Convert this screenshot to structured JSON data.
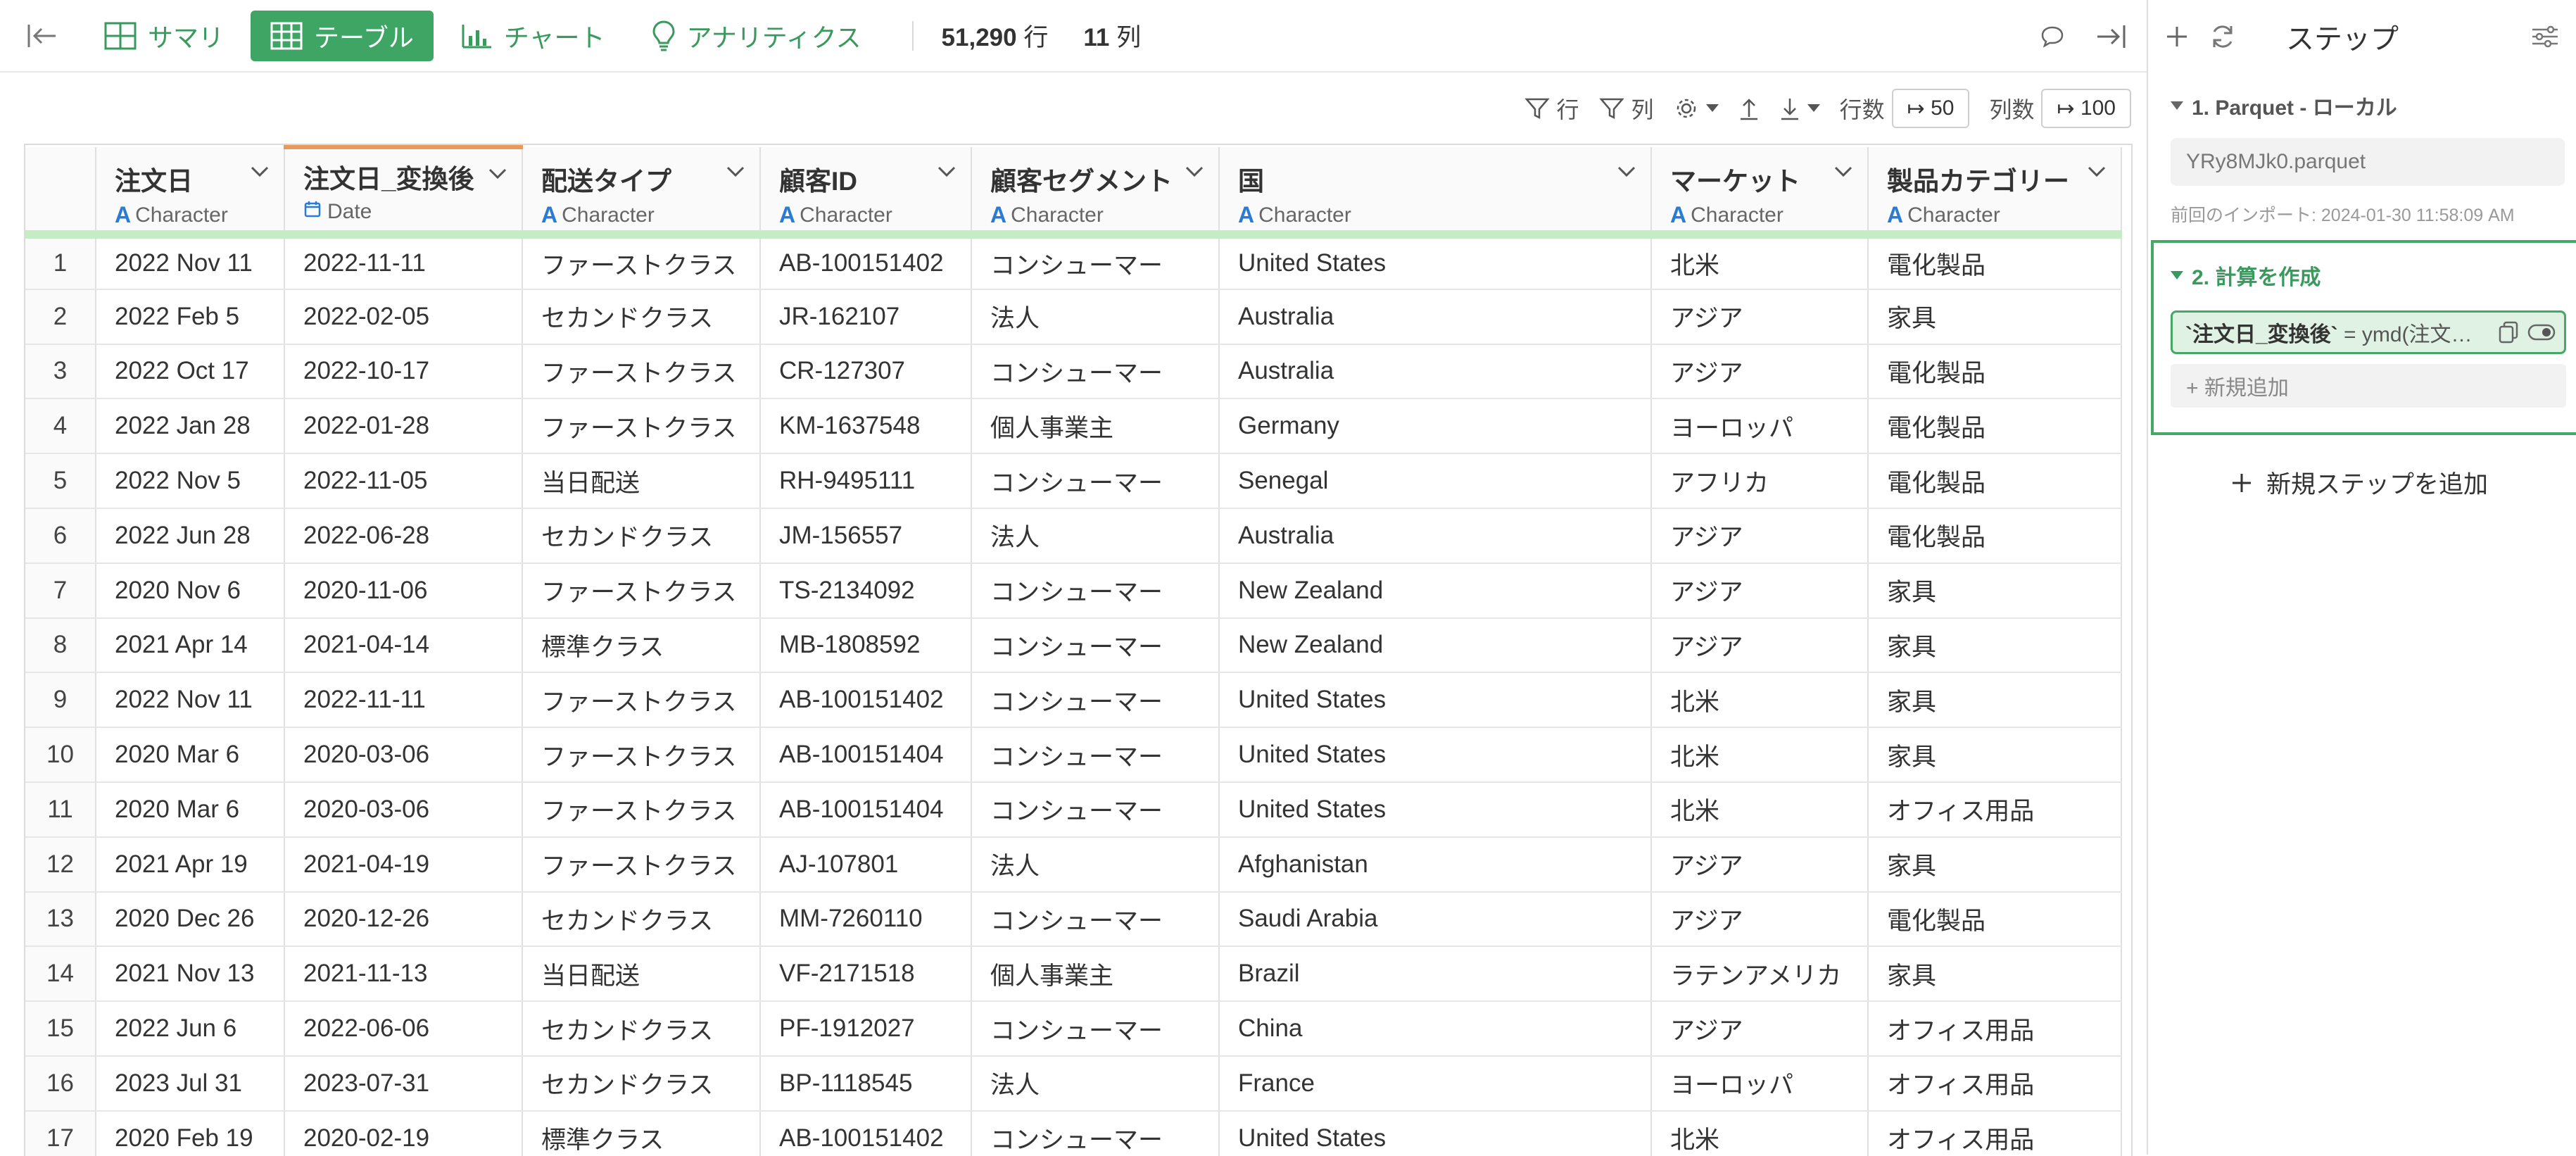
{
  "toolbar": {
    "tabs": [
      {
        "label": "サマリ",
        "icon": "table-outline-icon"
      },
      {
        "label": "テーブル",
        "icon": "table-grid-icon"
      },
      {
        "label": "チャート",
        "icon": "bar-chart-icon"
      },
      {
        "label": "アナリティクス",
        "icon": "lightbulb-icon"
      }
    ],
    "active_tab": "テーブル",
    "row_count": "51,290",
    "row_unit": "行",
    "col_count": "11",
    "col_unit": "列"
  },
  "controls": {
    "row_filter": "行",
    "col_filter": "列",
    "rows_label": "行数",
    "rows_value": "50",
    "cols_label": "列数",
    "cols_value": "100"
  },
  "table": {
    "columns": [
      {
        "name": "注文日",
        "type": "Character",
        "type_icon": "character-type-icon"
      },
      {
        "name": "注文日_変換後",
        "type": "Date",
        "type_icon": "calendar-icon"
      },
      {
        "name": "配送タイプ",
        "type": "Character",
        "type_icon": "character-type-icon"
      },
      {
        "name": "顧客ID",
        "type": "Character",
        "type_icon": "character-type-icon"
      },
      {
        "name": "顧客セグメント",
        "type": "Character",
        "type_icon": "character-type-icon"
      },
      {
        "name": "国",
        "type": "Character",
        "type_icon": "character-type-icon"
      },
      {
        "name": "マーケット",
        "type": "Character",
        "type_icon": "character-type-icon"
      },
      {
        "name": "製品カテゴリー",
        "type": "Character",
        "type_icon": "character-type-icon"
      }
    ],
    "rows": [
      [
        "1",
        "2022 Nov 11",
        "2022-11-11",
        "ファーストクラス",
        "AB-100151402",
        "コンシューマー",
        "United States",
        "北米",
        "電化製品"
      ],
      [
        "2",
        "2022 Feb 5",
        "2022-02-05",
        "セカンドクラス",
        "JR-162107",
        "法人",
        "Australia",
        "アジア",
        "家具"
      ],
      [
        "3",
        "2022 Oct 17",
        "2022-10-17",
        "ファーストクラス",
        "CR-127307",
        "コンシューマー",
        "Australia",
        "アジア",
        "電化製品"
      ],
      [
        "4",
        "2022 Jan 28",
        "2022-01-28",
        "ファーストクラス",
        "KM-1637548",
        "個人事業主",
        "Germany",
        "ヨーロッパ",
        "電化製品"
      ],
      [
        "5",
        "2022 Nov 5",
        "2022-11-05",
        "当日配送",
        "RH-9495111",
        "コンシューマー",
        "Senegal",
        "アフリカ",
        "電化製品"
      ],
      [
        "6",
        "2022 Jun 28",
        "2022-06-28",
        "セカンドクラス",
        "JM-156557",
        "法人",
        "Australia",
        "アジア",
        "電化製品"
      ],
      [
        "7",
        "2020 Nov 6",
        "2020-11-06",
        "ファーストクラス",
        "TS-2134092",
        "コンシューマー",
        "New Zealand",
        "アジア",
        "家具"
      ],
      [
        "8",
        "2021 Apr 14",
        "2021-04-14",
        "標準クラス",
        "MB-1808592",
        "コンシューマー",
        "New Zealand",
        "アジア",
        "家具"
      ],
      [
        "9",
        "2022 Nov 11",
        "2022-11-11",
        "ファーストクラス",
        "AB-100151402",
        "コンシューマー",
        "United States",
        "北米",
        "家具"
      ],
      [
        "10",
        "2020 Mar 6",
        "2020-03-06",
        "ファーストクラス",
        "AB-100151404",
        "コンシューマー",
        "United States",
        "北米",
        "家具"
      ],
      [
        "11",
        "2020 Mar 6",
        "2020-03-06",
        "ファーストクラス",
        "AB-100151404",
        "コンシューマー",
        "United States",
        "北米",
        "オフィス用品"
      ],
      [
        "12",
        "2021 Apr 19",
        "2021-04-19",
        "ファーストクラス",
        "AJ-107801",
        "法人",
        "Afghanistan",
        "アジア",
        "家具"
      ],
      [
        "13",
        "2020 Dec 26",
        "2020-12-26",
        "セカンドクラス",
        "MM-7260110",
        "コンシューマー",
        "Saudi Arabia",
        "アジア",
        "電化製品"
      ],
      [
        "14",
        "2021 Nov 13",
        "2021-11-13",
        "当日配送",
        "VF-2171518",
        "個人事業主",
        "Brazil",
        "ラテンアメリカ",
        "家具"
      ],
      [
        "15",
        "2022 Jun 6",
        "2022-06-06",
        "セカンドクラス",
        "PF-1912027",
        "コンシューマー",
        "China",
        "アジア",
        "オフィス用品"
      ],
      [
        "16",
        "2023 Jul 31",
        "2023-07-31",
        "セカンドクラス",
        "BP-1118545",
        "法人",
        "France",
        "ヨーロッパ",
        "オフィス用品"
      ],
      [
        "17",
        "2020 Feb 19",
        "2020-02-19",
        "標準クラス",
        "AB-100151402",
        "コンシューマー",
        "United States",
        "北米",
        "オフィス用品"
      ]
    ]
  },
  "panel": {
    "title": "ステップ",
    "step1": {
      "title": "1. Parquet - ローカル",
      "file": "YRy8MJk0.parquet",
      "meta": "前回のインポート: 2024-01-30 11:58:09 AM"
    },
    "step2": {
      "title": "2. 計算を作成",
      "formula_name": "`注文日_変換後`",
      "formula_rest": " = ymd(注文…",
      "add_label": "+ 新規追加"
    },
    "add_step_label": "新規ステップを追加"
  },
  "colors": {
    "accent": "#3fa565",
    "selected_column": "#e99a5b",
    "type_icon": "#2a7bd6"
  }
}
